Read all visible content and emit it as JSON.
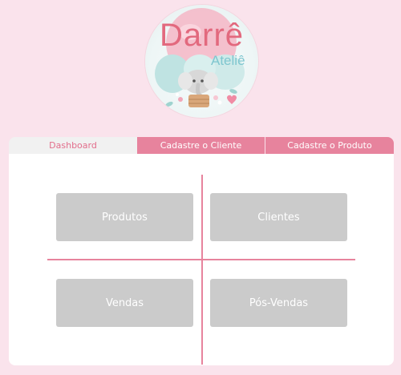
{
  "logo": {
    "title": "Darrê",
    "subtitle": "Ateliê",
    "brand_color": "#e2697e",
    "accent_color": "#7fc6cf"
  },
  "tabs": [
    {
      "label": "Dashboard",
      "active": true
    },
    {
      "label": "Cadastre o Cliente",
      "active": false
    },
    {
      "label": "Cadastre o Produto",
      "active": false
    }
  ],
  "cards": [
    {
      "label": "Produtos"
    },
    {
      "label": "Clientes"
    },
    {
      "label": "Vendas"
    },
    {
      "label": "Pós-Vendas"
    }
  ],
  "colors": {
    "background": "#fae3ec",
    "tab_pink": "#e7839d",
    "card_gray": "#cbcbcb",
    "active_tab_text": "#e26e8c"
  }
}
